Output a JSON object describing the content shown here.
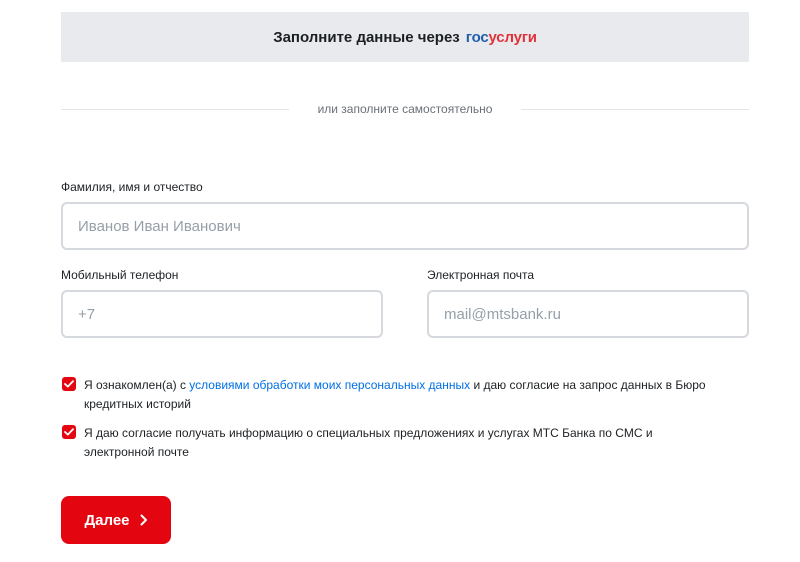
{
  "gosuslugi": {
    "text": "Заполните данные через",
    "logo_part1": "гос",
    "logo_part2": "услуги"
  },
  "divider": {
    "text": "или заполните самостоятельно"
  },
  "form": {
    "fio": {
      "label": "Фамилия, имя и отчество",
      "placeholder": "Иванов Иван Иванович",
      "value": ""
    },
    "phone": {
      "label": "Мобильный телефон",
      "placeholder": "+7",
      "value": ""
    },
    "email": {
      "label": "Электронная почта",
      "placeholder": "mail@mtsbank.ru",
      "value": ""
    }
  },
  "consents": [
    {
      "checked": true,
      "text_before": "Я ознакомлен(а) с ",
      "link": "условиями обработки моих персональных данных",
      "text_after": " и даю согласие на запрос данных в Бюро кредитных историй"
    },
    {
      "checked": true,
      "text": "Я даю согласие получать информацию о специальных предложениях и услугах МТС Банка по СМС и электронной почте"
    }
  ],
  "submit": {
    "label": "Далее",
    "icon": "chevron-right-icon"
  },
  "colors": {
    "accent": "#e30611",
    "link": "#0070e5",
    "banner_bg": "#e9eaed",
    "gos_blue": "#1f5fad",
    "gos_red": "#e0323a"
  }
}
